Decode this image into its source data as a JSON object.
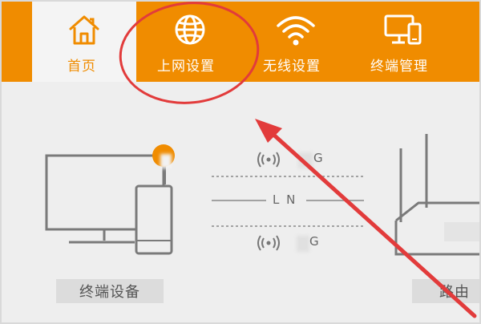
{
  "nav": {
    "home_label": "首页",
    "wan_label": "上网设置",
    "wifi_label": "无线设置",
    "terminal_label": "终端管理"
  },
  "status": {
    "band_top": "G",
    "lan": "L N",
    "band_bottom": "G"
  },
  "labels": {
    "terminal_devices": "终端设备",
    "router": "路由"
  },
  "colors": {
    "accent": "#f08c00",
    "annotation_red": "#e23b3b",
    "line_gray": "#888888"
  },
  "icons": {
    "home": "home-icon",
    "wan": "globe-icon",
    "wifi": "wifi-icon",
    "terminal": "devices-icon"
  }
}
